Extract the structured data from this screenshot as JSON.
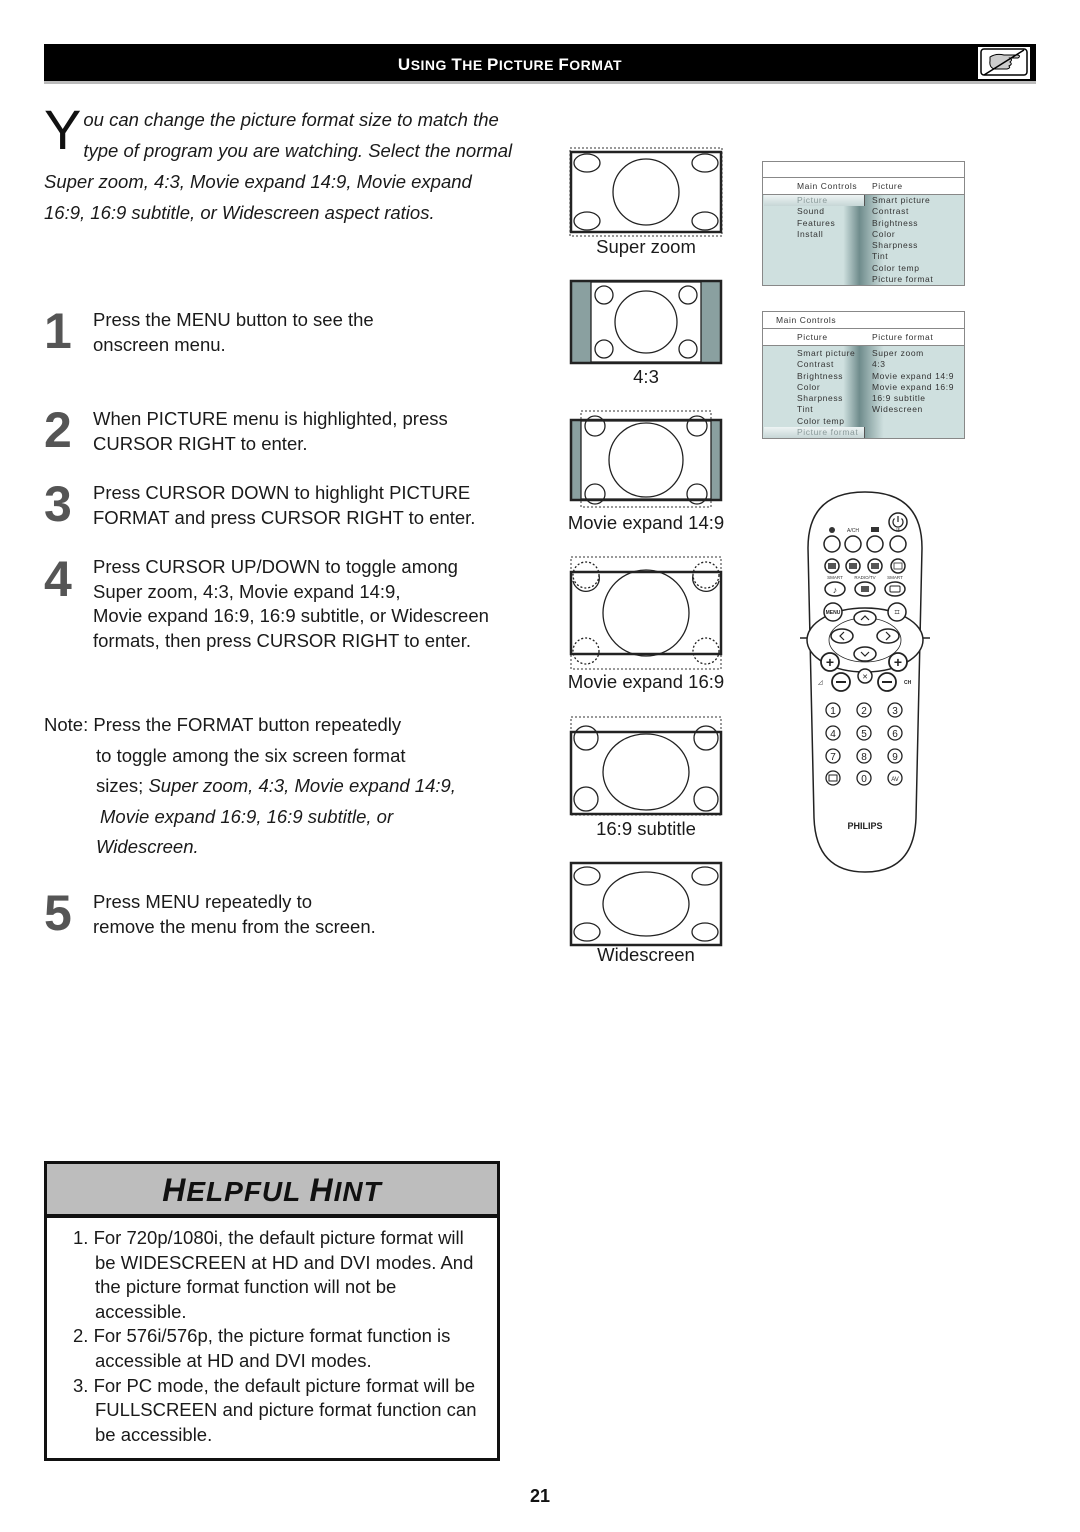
{
  "header": {
    "title_parts": [
      {
        "cap": "U",
        "rest": "SING"
      },
      {
        "cap": "T",
        "rest": "HE"
      },
      {
        "cap": "P",
        "rest": "ICTURE"
      },
      {
        "cap": "F",
        "rest": "ORMAT"
      }
    ],
    "title": "Using The Picture Format",
    "icon": "pointing-hand-icon"
  },
  "intro": {
    "drop_cap": "Y",
    "text": "ou can change the picture format size to match the type of program you are watching. Select the normal Super zoom, 4:3, Movie expand 14:9, Movie expand 16:9, 16:9 subtitle, or Widescreen aspect ratios."
  },
  "steps": [
    {
      "number": "1",
      "lines": [
        "Press the MENU button to see the",
        "onscreen menu."
      ]
    },
    {
      "number": "2",
      "lines": [
        "When PICTURE menu is highlighted,  press",
        "CURSOR RIGHT to enter."
      ]
    },
    {
      "number": "3",
      "lines": [
        "Press CURSOR DOWN to highlight PICTURE",
        "FORMAT and press CURSOR RIGHT to enter."
      ]
    },
    {
      "number": "4",
      "lines": [
        "Press CURSOR UP/DOWN to toggle among",
        "Super zoom, 4:3, Movie expand 14:9,",
        "Movie expand 16:9, 16:9 subtitle, or Widescreen",
        "formats, then press CURSOR RIGHT to enter."
      ]
    },
    {
      "number": "5",
      "lines": [
        "Press MENU repeatedly to",
        "remove the menu from the screen."
      ]
    }
  ],
  "note": {
    "line1": "Note: Press the FORMAT button repeatedly",
    "line2": "to toggle among the six screen format",
    "line3_plain": "sizes; ",
    "line3_italic": "Super zoom, 4:3, Movie expand 14:9,",
    "line4_italic": "Movie expand 16:9, 16:9 subtitle, or",
    "line5_italic": "Widescreen."
  },
  "formats": [
    {
      "label": "Super zoom"
    },
    {
      "label": "4:3"
    },
    {
      "label": "Movie expand 14:9"
    },
    {
      "label": "Movie expand 16:9"
    },
    {
      "label": "16:9 subtitle"
    },
    {
      "label": "Widescreen"
    }
  ],
  "menu1": {
    "header_left": "Main Controls",
    "header_right": "Picture",
    "left_items": [
      "Picture",
      "Sound",
      "Features",
      "Install"
    ],
    "right_items": [
      "Smart picture",
      "Contrast",
      "Brightness",
      "Color",
      "Sharpness",
      "Tint",
      "Color temp",
      "Picture format"
    ],
    "selected_left": "Picture"
  },
  "menu2": {
    "title": "Main Controls",
    "header_left": "Picture",
    "header_right": "Picture format",
    "left_items": [
      "Smart picture",
      "Contrast",
      "Brightness",
      "Color",
      "Sharpness",
      "Tint",
      "Color temp",
      "Picture format"
    ],
    "right_items": [
      "Super zoom",
      "4:3",
      "Movie expand 14:9",
      "Movie expand 16:9",
      "16:9 subtitle",
      "Widescreen"
    ],
    "selected_left": "Picture format"
  },
  "remote": {
    "brand": "PHILIPS",
    "labels": {
      "aich": "A/CH",
      "smart1": "SMART",
      "radiotv": "RADIO/TV",
      "smart2": "SMART",
      "menu": "MENU",
      "ch": "CH",
      "av": "AV"
    },
    "digits": [
      "1",
      "2",
      "3",
      "4",
      "5",
      "6",
      "7",
      "8",
      "9",
      "0"
    ]
  },
  "hint": {
    "title_parts": [
      {
        "cap": "H",
        "rest": "ELPFUL"
      },
      {
        "cap": "H",
        "rest": "INT"
      }
    ],
    "items": [
      "1. For 720p/1080i, the default picture format will be WIDESCREEN at HD and DVI modes. And the picture format function will not be accessible.",
      "2. For 576i/576p, the picture format function is accessible at HD and DVI modes.",
      "3. For PC mode, the default picture format will be FULLSCREEN and picture format function can be accessible."
    ]
  },
  "page_number": "21"
}
